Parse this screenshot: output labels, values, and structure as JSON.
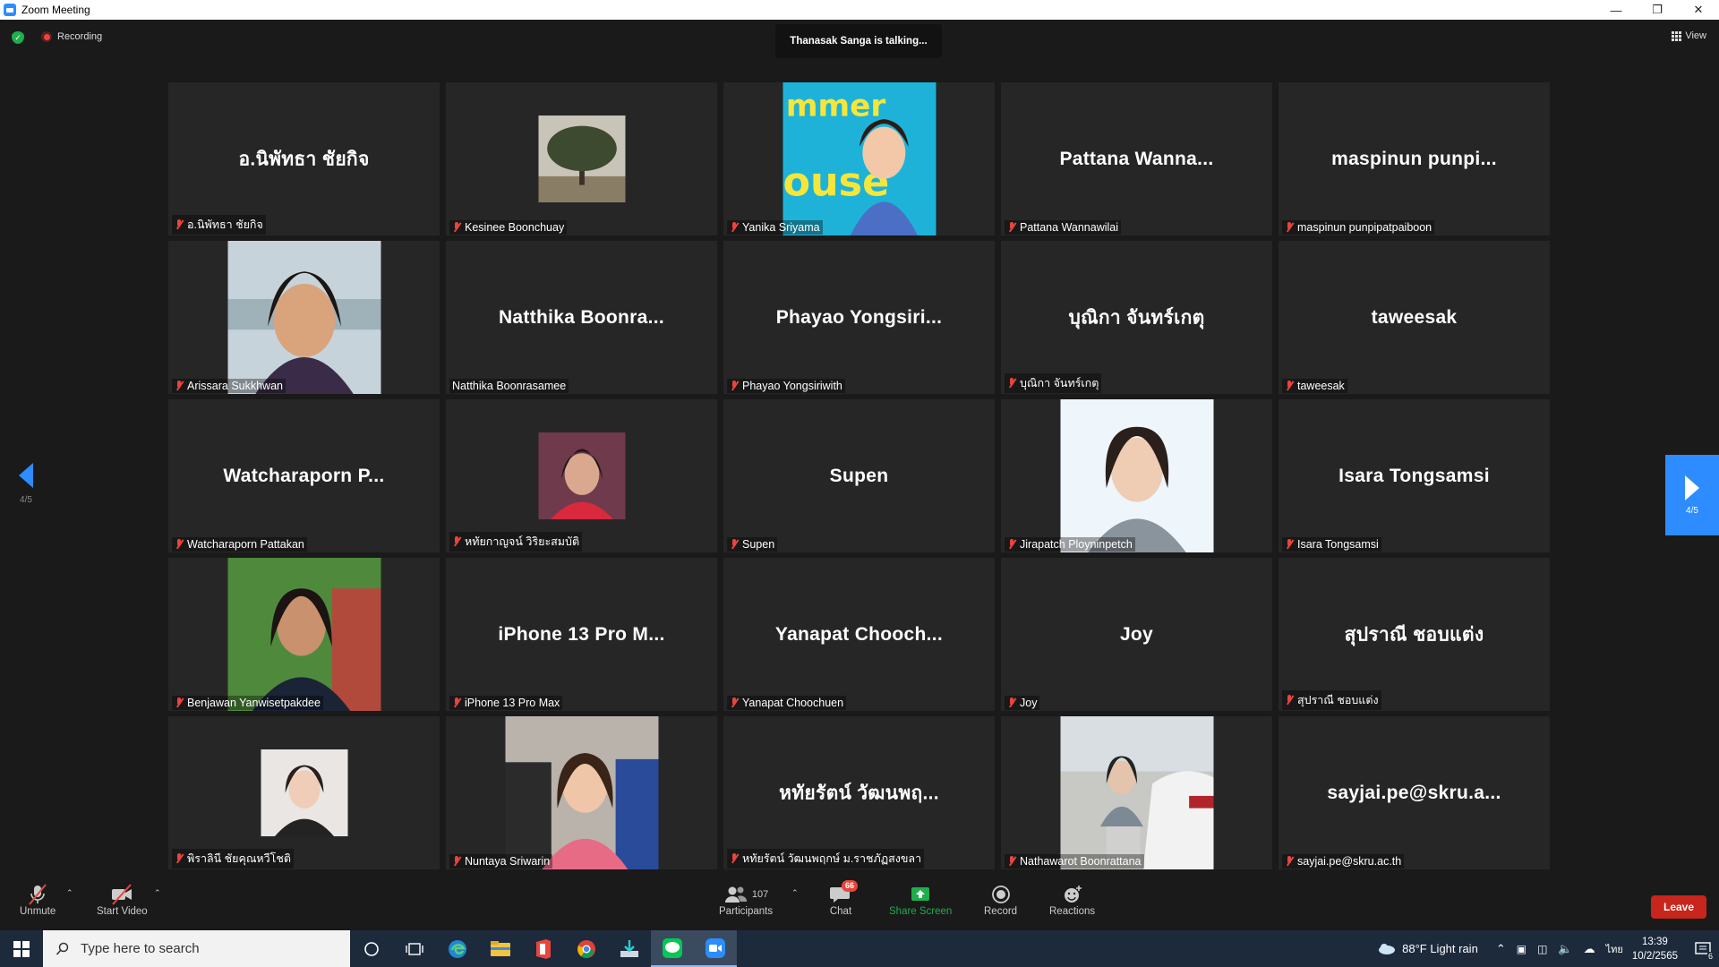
{
  "window": {
    "title": "Zoom Meeting"
  },
  "top": {
    "recording_label": "Recording",
    "talking": "Thanasak Sanga is talking...",
    "view_label": "View"
  },
  "pager": {
    "left": "4/5",
    "right": "4/5"
  },
  "participants": [
    {
      "tile_name": "อ.นิพัทธา ชัยกิจ",
      "label": "อ.นิพัทธา ชัยกิจ",
      "muted": true,
      "video": "none"
    },
    {
      "tile_name": "",
      "label": "Kesinee Boonchuay",
      "muted": true,
      "video": "small-photo",
      "photo": "tree"
    },
    {
      "tile_name": "",
      "label": "Yanika Sriyama",
      "muted": true,
      "video": "photo",
      "photo": "cafe"
    },
    {
      "tile_name": "Pattana Wanna...",
      "label": "Pattana Wannawilai",
      "muted": true,
      "video": "none"
    },
    {
      "tile_name": "maspinun punpi...",
      "label": "maspinun punpipatpaiboon",
      "muted": true,
      "video": "none"
    },
    {
      "tile_name": "",
      "label": "Arissara Sukkhwan",
      "muted": true,
      "video": "photo",
      "photo": "beach"
    },
    {
      "tile_name": "Natthika Boonra...",
      "label": "Natthika Boonrasamee",
      "muted": false,
      "video": "none"
    },
    {
      "tile_name": "Phayao Yongsiri...",
      "label": "Phayao Yongsiriwith",
      "muted": true,
      "video": "none"
    },
    {
      "tile_name": "บุณิกา จันทร์เกตุ",
      "label": "บุณิกา จันทร์เกตุ",
      "muted": true,
      "video": "none"
    },
    {
      "tile_name": "taweesak",
      "label": "taweesak",
      "muted": true,
      "video": "none"
    },
    {
      "tile_name": "Watcharaporn P...",
      "label": "Watcharaporn Pattakan",
      "muted": true,
      "video": "none"
    },
    {
      "tile_name": "",
      "label": "หทัยกาญจน์ วิริยะสมบัติ",
      "muted": true,
      "video": "small-photo",
      "photo": "red"
    },
    {
      "tile_name": "Supen",
      "label": "Supen",
      "muted": true,
      "video": "none"
    },
    {
      "tile_name": "",
      "label": "Jirapatch Ployninpetch",
      "muted": true,
      "video": "photo",
      "photo": "studio"
    },
    {
      "tile_name": "Isara Tongsamsi",
      "label": "Isara Tongsamsi",
      "muted": true,
      "video": "none"
    },
    {
      "tile_name": "",
      "label": "Benjawan Yanwisetpakdee",
      "muted": true,
      "video": "photo",
      "photo": "garden"
    },
    {
      "tile_name": "iPhone 13 Pro M...",
      "label": "iPhone 13 Pro Max",
      "muted": true,
      "video": "none"
    },
    {
      "tile_name": "Yanapat Chooch...",
      "label": "Yanapat Choochuen",
      "muted": true,
      "video": "none"
    },
    {
      "tile_name": "Joy",
      "label": "Joy",
      "muted": true,
      "video": "none"
    },
    {
      "tile_name": "สุปราณี ชอบแต่ง",
      "label": "สุปราณี ชอบแต่ง",
      "muted": true,
      "video": "none"
    },
    {
      "tile_name": "",
      "label": "พิราลินี ชัยคุณหวีโชติ",
      "muted": true,
      "video": "small-photo",
      "photo": "portrait"
    },
    {
      "tile_name": "",
      "label": "Nuntaya Sriwarin",
      "muted": true,
      "video": "photo",
      "photo": "crowd"
    },
    {
      "tile_name": "หทัยรัตน์ วัฒนพฤ...",
      "label": "หทัยรัตน์ วัฒนพฤกษ์ ม.ราชภัฏสงขลา",
      "muted": true,
      "video": "none"
    },
    {
      "tile_name": "",
      "label": "Nathawarot Boonrattana",
      "muted": true,
      "video": "photo",
      "photo": "car"
    },
    {
      "tile_name": "sayjai.pe@skru.a...",
      "label": "sayjai.pe@skru.ac.th",
      "muted": true,
      "video": "none"
    }
  ],
  "controls": {
    "unmute": "Unmute",
    "start_video": "Start Video",
    "participants_count": "107",
    "participants": "Participants",
    "chat": "Chat",
    "chat_badge": "66",
    "share_screen": "Share Screen",
    "record": "Record",
    "reactions": "Reactions",
    "leave": "Leave"
  },
  "taskbar": {
    "search_placeholder": "Type here to search",
    "weather": "88°F  Light rain",
    "language": "ไทย",
    "time": "13:39",
    "date": "10/2/2565",
    "notification_count": "6"
  },
  "colors": {
    "accent": "#2d8cff",
    "leave": "#c8251c",
    "share": "#1fae4b",
    "mute": "#e8453c"
  }
}
